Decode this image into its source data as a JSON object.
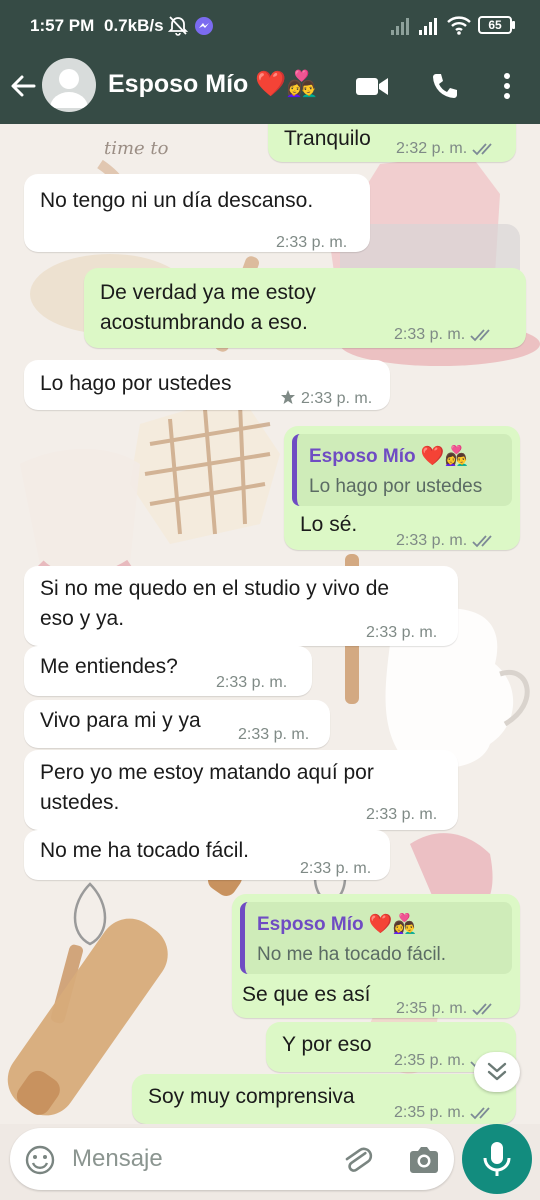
{
  "status_bar": {
    "time": "1:57 PM",
    "network_speed": "0.7kB/s",
    "battery": "65"
  },
  "header": {
    "contact_name": "Esposo Mío ❤️👩‍❤️‍👨",
    "icons": [
      "back-arrow-icon",
      "avatar",
      "video-call-icon",
      "phone-call-icon",
      "more-vertical-icon"
    ]
  },
  "background_text": "time to",
  "messages": [
    {
      "dir": "out",
      "text": "Tranquilo",
      "time": "2:32 p. m."
    },
    {
      "dir": "in",
      "text": "No tengo ni un día descanso.",
      "time": "2:33 p. m."
    },
    {
      "dir": "out",
      "lines": [
        "De verdad ya me estoy",
        "acostumbrando a eso."
      ],
      "time": "2:33 p. m."
    },
    {
      "dir": "in",
      "text": "Lo hago por ustedes",
      "time": "2:33 p. m.",
      "starred": true
    },
    {
      "dir": "out",
      "reply_to": {
        "name": "Esposo Mío ❤️👩‍❤️‍👨",
        "text": "Lo hago por ustedes"
      },
      "text": "Lo sé.",
      "time": "2:33 p. m."
    },
    {
      "dir": "in",
      "lines": [
        "Si no me quedo en el studio y vivo de",
        "eso y ya."
      ],
      "time": "2:33 p. m."
    },
    {
      "dir": "in",
      "text": "Me entiendes?",
      "time": "2:33 p. m."
    },
    {
      "dir": "in",
      "text": "Vivo para mi y ya",
      "time": "2:33 p. m."
    },
    {
      "dir": "in",
      "lines": [
        "Pero yo me estoy matando aquí por",
        "ustedes."
      ],
      "time": "2:33 p. m."
    },
    {
      "dir": "in",
      "text": "No me ha tocado fácil.",
      "time": "2:33 p. m."
    },
    {
      "dir": "out",
      "reply_to": {
        "name": "Esposo Mío ❤️👩‍❤️‍👨",
        "text": "No me ha tocado fácil."
      },
      "text": "Se que es así",
      "time": "2:35 p. m."
    },
    {
      "dir": "out",
      "text": "Y por eso",
      "time": "2:35 p. m."
    },
    {
      "dir": "out",
      "text": "Soy muy comprensiva",
      "time": "2:35 p. m."
    }
  ],
  "composer": {
    "placeholder": "Mensaje"
  },
  "colors": {
    "header_bg": "#364b45",
    "outgoing_bubble": "#dcf8c6",
    "incoming_bubble": "#ffffff",
    "read_ticks": "#7d8a96",
    "quote_accent": "#6f4cc3",
    "mic_button": "#128c7e"
  }
}
